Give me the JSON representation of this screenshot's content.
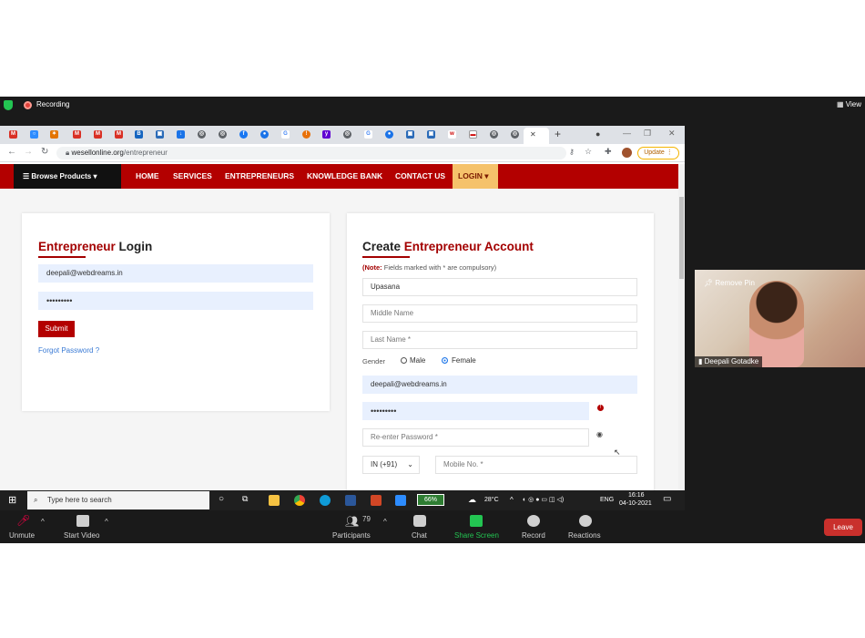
{
  "zoom": {
    "recording_label": "Recording",
    "view_label": "View",
    "remove_pin_label": "Remove Pin",
    "participant_name": "Deepali Gotadke",
    "controls": {
      "unmute": "Unmute",
      "start_video": "Start Video",
      "participants": "Participants",
      "participants_count": "79",
      "chat": "Chat",
      "share_screen": "Share Screen",
      "record": "Record",
      "reactions": "Reactions",
      "leave": "Leave"
    }
  },
  "browser": {
    "url_host": "wesellonline.org",
    "url_path": "/entrepreneur",
    "update_label": "Update"
  },
  "site": {
    "browse_products": "Browse Products",
    "nav": [
      "HOME",
      "SERVICES",
      "ENTREPRENEURS",
      "KNOWLEDGE BANK",
      "CONTACT US",
      "LOGIN"
    ],
    "login": {
      "title_red": "Entrepreneur",
      "title_rest": "Login",
      "email_value": "deepali@webdreams.in",
      "password_value": "•••••••••",
      "submit": "Submit",
      "forgot": "Forgot Password ?"
    },
    "create": {
      "title_start": "Create",
      "title_red": "Entrepreneur Account",
      "note_prefix": "(Note:",
      "note_text": "Fields marked with * are compulsory)",
      "first_name_value": "Upasana",
      "middle_name_placeholder": "Middle Name",
      "last_name_placeholder": "Last Name *",
      "gender_label": "Gender",
      "gender_male": "Male",
      "gender_female": "Female",
      "gender_selected": "Female",
      "email_value": "deepali@webdreams.in",
      "password_value": "•••••••••",
      "reenter_placeholder": "Re-enter Password *",
      "country_code": "IN (+91)",
      "mobile_placeholder": "Mobile No. *"
    }
  },
  "taskbar": {
    "search_placeholder": "Type here to search",
    "battery": "66%",
    "weather": "28°C",
    "lang": "ENG",
    "time": "16:16",
    "date": "04-10-2021"
  }
}
